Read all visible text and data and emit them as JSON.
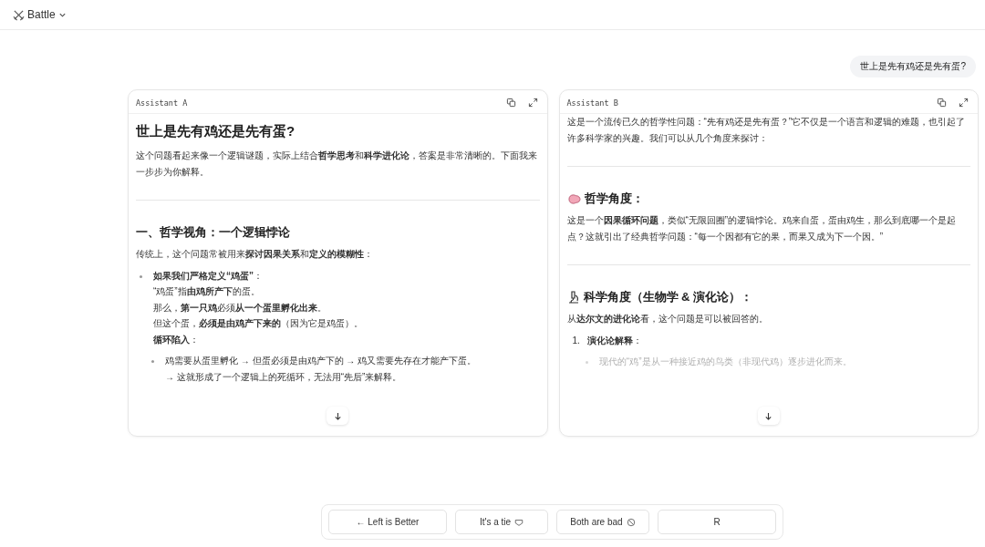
{
  "header": {
    "title": "Battle"
  },
  "user_message": "世上是先有鸡还是先有蛋?",
  "panels": [
    {
      "label": "Assistant A",
      "blocks": [
        {
          "kind": "h1",
          "text": "世上是先有鸡还是先有蛋?"
        },
        {
          "kind": "p",
          "text": "这个问题看起来像一个逻辑谜题，实际上结合**哲学思考**和**科学进化论**，答案是非常清晰的。下面我来一步步为你解释。"
        },
        {
          "kind": "rule"
        },
        {
          "kind": "h2",
          "text": "一、哲学视角：一个逻辑悖论"
        },
        {
          "kind": "p",
          "text": "传统上，这个问题常被用来**探讨因果关系**和**定义的模糊性**："
        },
        {
          "kind": "bullet",
          "lines": [
            "**如果我们严格定义“鸡蛋”**：",
            "“鸡蛋”指**由鸡所产下**的蛋。",
            "那么，**第一只鸡**必须**从一个蛋里孵化出来**。",
            "但这个蛋，**必须是由鸡产下来的**（因为它是鸡蛋）。",
            "**循环陷入**："
          ],
          "children": [
            {
              "faded": false,
              "lines": [
                "鸡需要从蛋里孵化 → 但蛋必须是由鸡产下的 → 鸡又需要先存在才能产下蛋。",
                "→ 这就形成了一个逻辑上的死循环，无法用“先后”来解释。"
              ]
            }
          ]
        }
      ]
    },
    {
      "label": "Assistant B",
      "blocks": [
        {
          "kind": "p",
          "text": "这是一个流传已久的哲学性问题：“先有鸡还是先有蛋？”它不仅是一个语言和逻辑的难题，也引起了许多科学家的兴趣。我们可以从几个角度来探讨："
        },
        {
          "kind": "rule"
        },
        {
          "kind": "h2-icon",
          "text": "哲学角度："
        },
        {
          "kind": "p",
          "text": "这是一个**因果循环问题**，类似“无限回圈”的逻辑悖论。鸡来自蛋，蛋由鸡生，那么到底哪一个是起点？这就引出了经典哲学问题：“每一个因都有它的果，而果又成为下一个因。”"
        },
        {
          "kind": "rule"
        },
        {
          "kind": "h2-icon",
          "text": "科学角度（生物学 & 演化论）："
        },
        {
          "kind": "p",
          "text": "从**达尔文的进化论**看，这个问题是可以被回答的。"
        },
        {
          "kind": "numbered",
          "number": "1.",
          "lines": [
            "**演化论解释**："
          ],
          "children": [
            {
              "faded": true,
              "lines": [
                "现代的“鸡”是从一种接近鸡的鸟类（非现代鸡）逐步进化而来。"
              ]
            }
          ]
        }
      ]
    }
  ],
  "vote_buttons": [
    {
      "label": "← Left is Better"
    },
    {
      "label": "It's a tie"
    },
    {
      "label": "Both are bad"
    },
    {
      "label": "R"
    }
  ]
}
